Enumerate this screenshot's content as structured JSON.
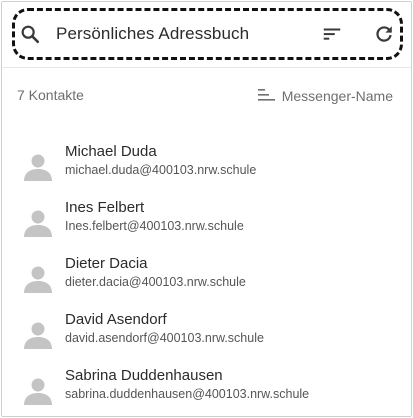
{
  "header": {
    "title": "Persönliches Adressbuch",
    "icons": {
      "search": "search-icon",
      "sort": "sort-icon",
      "refresh": "refresh-icon"
    }
  },
  "summary": {
    "count_label": "7 Kontakte",
    "sort_label": "Messenger-Name"
  },
  "contacts": [
    {
      "name": "Michael Duda",
      "email": "michael.duda@400103.nrw.schule"
    },
    {
      "name": "Ines Felbert",
      "email": "Ines.felbert@400103.nrw.schule"
    },
    {
      "name": "Dieter Dacia",
      "email": "dieter.dacia@400103.nrw.schule"
    },
    {
      "name": "David Asendorf",
      "email": "david.asendorf@400103.nrw.schule"
    },
    {
      "name": "Sabrina Duddenhausen",
      "email": "sabrina.duddenhausen@400103.nrw.schule"
    }
  ],
  "colors": {
    "icon": "#3a3a3a",
    "avatar": "#c4c4c4",
    "muted_text": "#6f6f6f"
  }
}
